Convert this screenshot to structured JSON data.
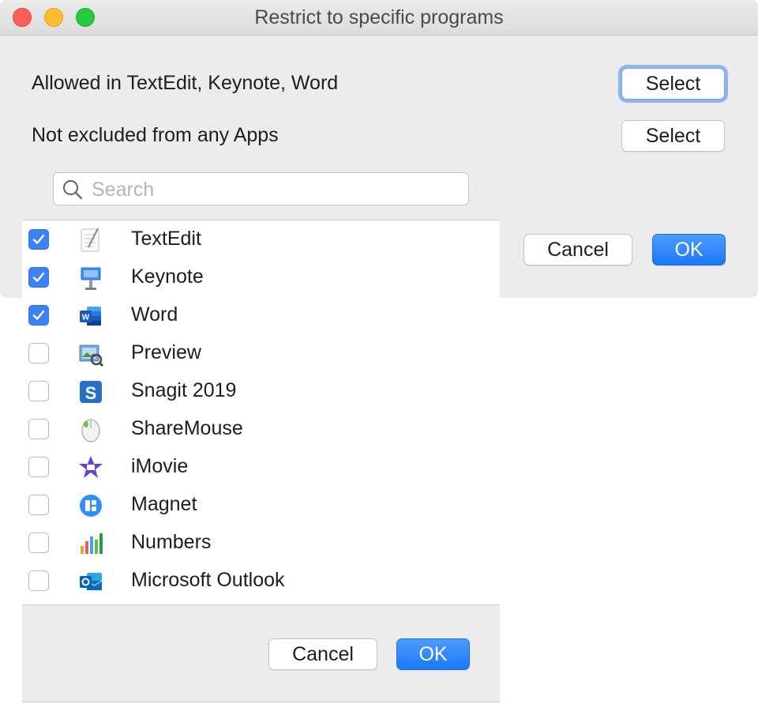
{
  "window": {
    "title": "Restrict to specific programs",
    "allowed_label": "Allowed in TextEdit, Keynote, Word",
    "allowed_select": "Select",
    "excluded_label": "Not excluded from any Apps",
    "excluded_select": "Select",
    "cancel": "Cancel",
    "ok": "OK"
  },
  "popup": {
    "search_placeholder": "Search",
    "search_value": "",
    "apps": [
      {
        "name": "TextEdit",
        "checked": true,
        "icon": "textedit-icon"
      },
      {
        "name": "Keynote",
        "checked": true,
        "icon": "keynote-icon"
      },
      {
        "name": "Word",
        "checked": true,
        "icon": "word-icon"
      },
      {
        "name": "Preview",
        "checked": false,
        "icon": "preview-icon"
      },
      {
        "name": "Snagit 2019",
        "checked": false,
        "icon": "snagit-icon"
      },
      {
        "name": "ShareMouse",
        "checked": false,
        "icon": "sharemouse-icon"
      },
      {
        "name": "iMovie",
        "checked": false,
        "icon": "imovie-icon"
      },
      {
        "name": "Magnet",
        "checked": false,
        "icon": "magnet-icon"
      },
      {
        "name": "Numbers",
        "checked": false,
        "icon": "numbers-icon"
      },
      {
        "name": "Microsoft Outlook",
        "checked": false,
        "icon": "outlook-icon"
      }
    ],
    "cancel": "Cancel",
    "ok": "OK"
  },
  "colors": {
    "accent": "#1c78f5",
    "checkbox_on": "#3b82f6",
    "focus_ring": "#8fb4f0",
    "traffic_close": "#fe5f57",
    "traffic_min": "#febc2e",
    "traffic_max": "#28c840"
  }
}
